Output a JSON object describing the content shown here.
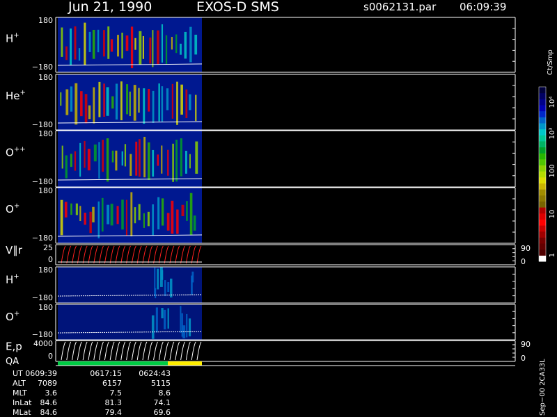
{
  "header": {
    "date": "Jun 21, 1990",
    "instrument": "EXOS-D SMS",
    "file": "s0062131.par",
    "time": "06:09:39"
  },
  "panels": [
    {
      "label": "H",
      "sup": "+",
      "ticks": [
        "180",
        "−180"
      ],
      "kind": "spec"
    },
    {
      "label": "He",
      "sup": "+",
      "ticks": [
        "180",
        "−180"
      ],
      "kind": "spec"
    },
    {
      "label": "O",
      "sup": "++",
      "ticks": [
        "180",
        "−180"
      ],
      "kind": "spec"
    },
    {
      "label": "O",
      "sup": "+",
      "ticks": [
        "180",
        "−180"
      ],
      "kind": "spec"
    },
    {
      "label": "V∥r",
      "sup": "",
      "ticks": [
        "25",
        "0"
      ],
      "kind": "line",
      "right_ticks": [
        "90",
        "0"
      ]
    },
    {
      "label": "H",
      "sup": "+",
      "ticks": [
        "180",
        "−180"
      ],
      "kind": "spec2"
    },
    {
      "label": "O",
      "sup": "+",
      "ticks": [
        "180",
        "−180"
      ],
      "kind": "spec2"
    },
    {
      "label": "E,p",
      "sup": "",
      "ticks": [
        "4000",
        "0"
      ],
      "kind": "line2",
      "right_ticks": [
        "90",
        "0"
      ]
    }
  ],
  "qa_label": "QA",
  "colorbar": {
    "unit": "Ct/Smp",
    "tick_labels": [
      "10⁴",
      "10³",
      "100",
      "10",
      "1"
    ],
    "colors": [
      "#00003c",
      "#000064",
      "#00008c",
      "#0000b4",
      "#0028c8",
      "#0064c8",
      "#0096c8",
      "#00c8c8",
      "#00c896",
      "#00b464",
      "#00a028",
      "#28b400",
      "#50c800",
      "#8cd200",
      "#b4dc00",
      "#dcdc00",
      "#c8b400",
      "#a08c00",
      "#8c7800",
      "#786400",
      "#b40000",
      "#dc0000",
      "#ff0000",
      "#c80000",
      "#a00000",
      "#780000",
      "#640000",
      "#500000",
      "#ffffff"
    ]
  },
  "footer": {
    "rows": [
      {
        "name": "UT",
        "values": [
          "0609:39",
          "0617:15",
          "0624:43"
        ]
      },
      {
        "name": "ALT",
        "values": [
          "7089",
          "6157",
          "5115"
        ]
      },
      {
        "name": "MLT",
        "values": [
          "3.6",
          "7.5",
          "8.6"
        ]
      },
      {
        "name": "InLat",
        "values": [
          "84.6",
          "81.3",
          "74.1"
        ]
      },
      {
        "name": "MLat",
        "values": [
          "84.6",
          "79.4",
          "69.6"
        ]
      }
    ],
    "version": "Sep−00 2CA33L"
  },
  "chart_data": {
    "type": "heatmap",
    "title": "Jun 21, 1990   EXOS-D SMS",
    "x_ticks_ut": [
      "0609:39",
      "0617:15",
      "0624:43"
    ],
    "panels": [
      "H+",
      "He+",
      "O++",
      "O+",
      "V∥r",
      "H+",
      "O+",
      "E,p"
    ],
    "y_ranges": [
      [
        -180,
        180
      ],
      [
        -180,
        180
      ],
      [
        -180,
        180
      ],
      [
        -180,
        180
      ],
      [
        0,
        25
      ],
      [
        -180,
        180
      ],
      [
        -180,
        180
      ],
      [
        0,
        4000
      ]
    ],
    "colorbar_unit": "Ct/Smp",
    "colorbar_range": [
      1,
      10000
    ],
    "qa_segments": [
      {
        "status": "good",
        "color": "#00cc44"
      },
      {
        "status": "fair",
        "color": "#ffee00"
      }
    ]
  }
}
